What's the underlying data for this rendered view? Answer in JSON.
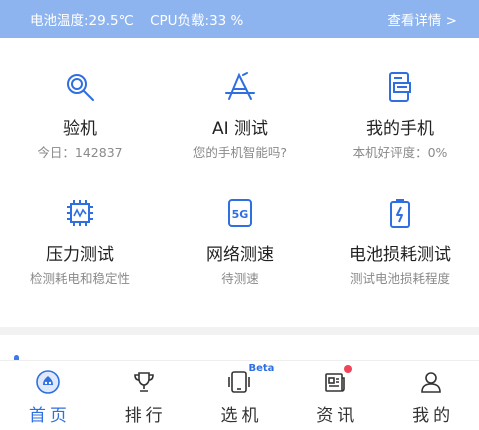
{
  "status": {
    "battery_temp": "电池温度:29.5℃",
    "cpu_load": "CPU负载:33 %",
    "details_link": "查看详情 >"
  },
  "features": [
    {
      "title": "验机",
      "subtitle": "今日：142837",
      "icon": "magnifier-icon"
    },
    {
      "title": "AI 测试",
      "subtitle": "您的手机智能吗?",
      "icon": "ai-icon"
    },
    {
      "title": "我的手机",
      "subtitle": "本机好评度：0%",
      "icon": "phone-info-icon"
    },
    {
      "title": "压力测试",
      "subtitle": "检测耗电和稳定性",
      "icon": "chip-icon"
    },
    {
      "title": "网络测速",
      "subtitle": "待测速",
      "icon": "5g-icon"
    },
    {
      "title": "电池损耗测试",
      "subtitle": "测试电池损耗程度",
      "icon": "battery-icon"
    }
  ],
  "tabs": [
    {
      "label": "首页",
      "icon": "home-icon",
      "active": true
    },
    {
      "label": "排行",
      "icon": "trophy-icon"
    },
    {
      "label": "选机",
      "icon": "phone-select-icon",
      "badge": "Beta"
    },
    {
      "label": "资讯",
      "icon": "news-icon",
      "dot": true
    },
    {
      "label": "我的",
      "icon": "user-icon"
    }
  ],
  "colors": {
    "accent": "#2f6fe0",
    "status_bg": "#8db4ef",
    "badge_red": "#f0445b"
  }
}
